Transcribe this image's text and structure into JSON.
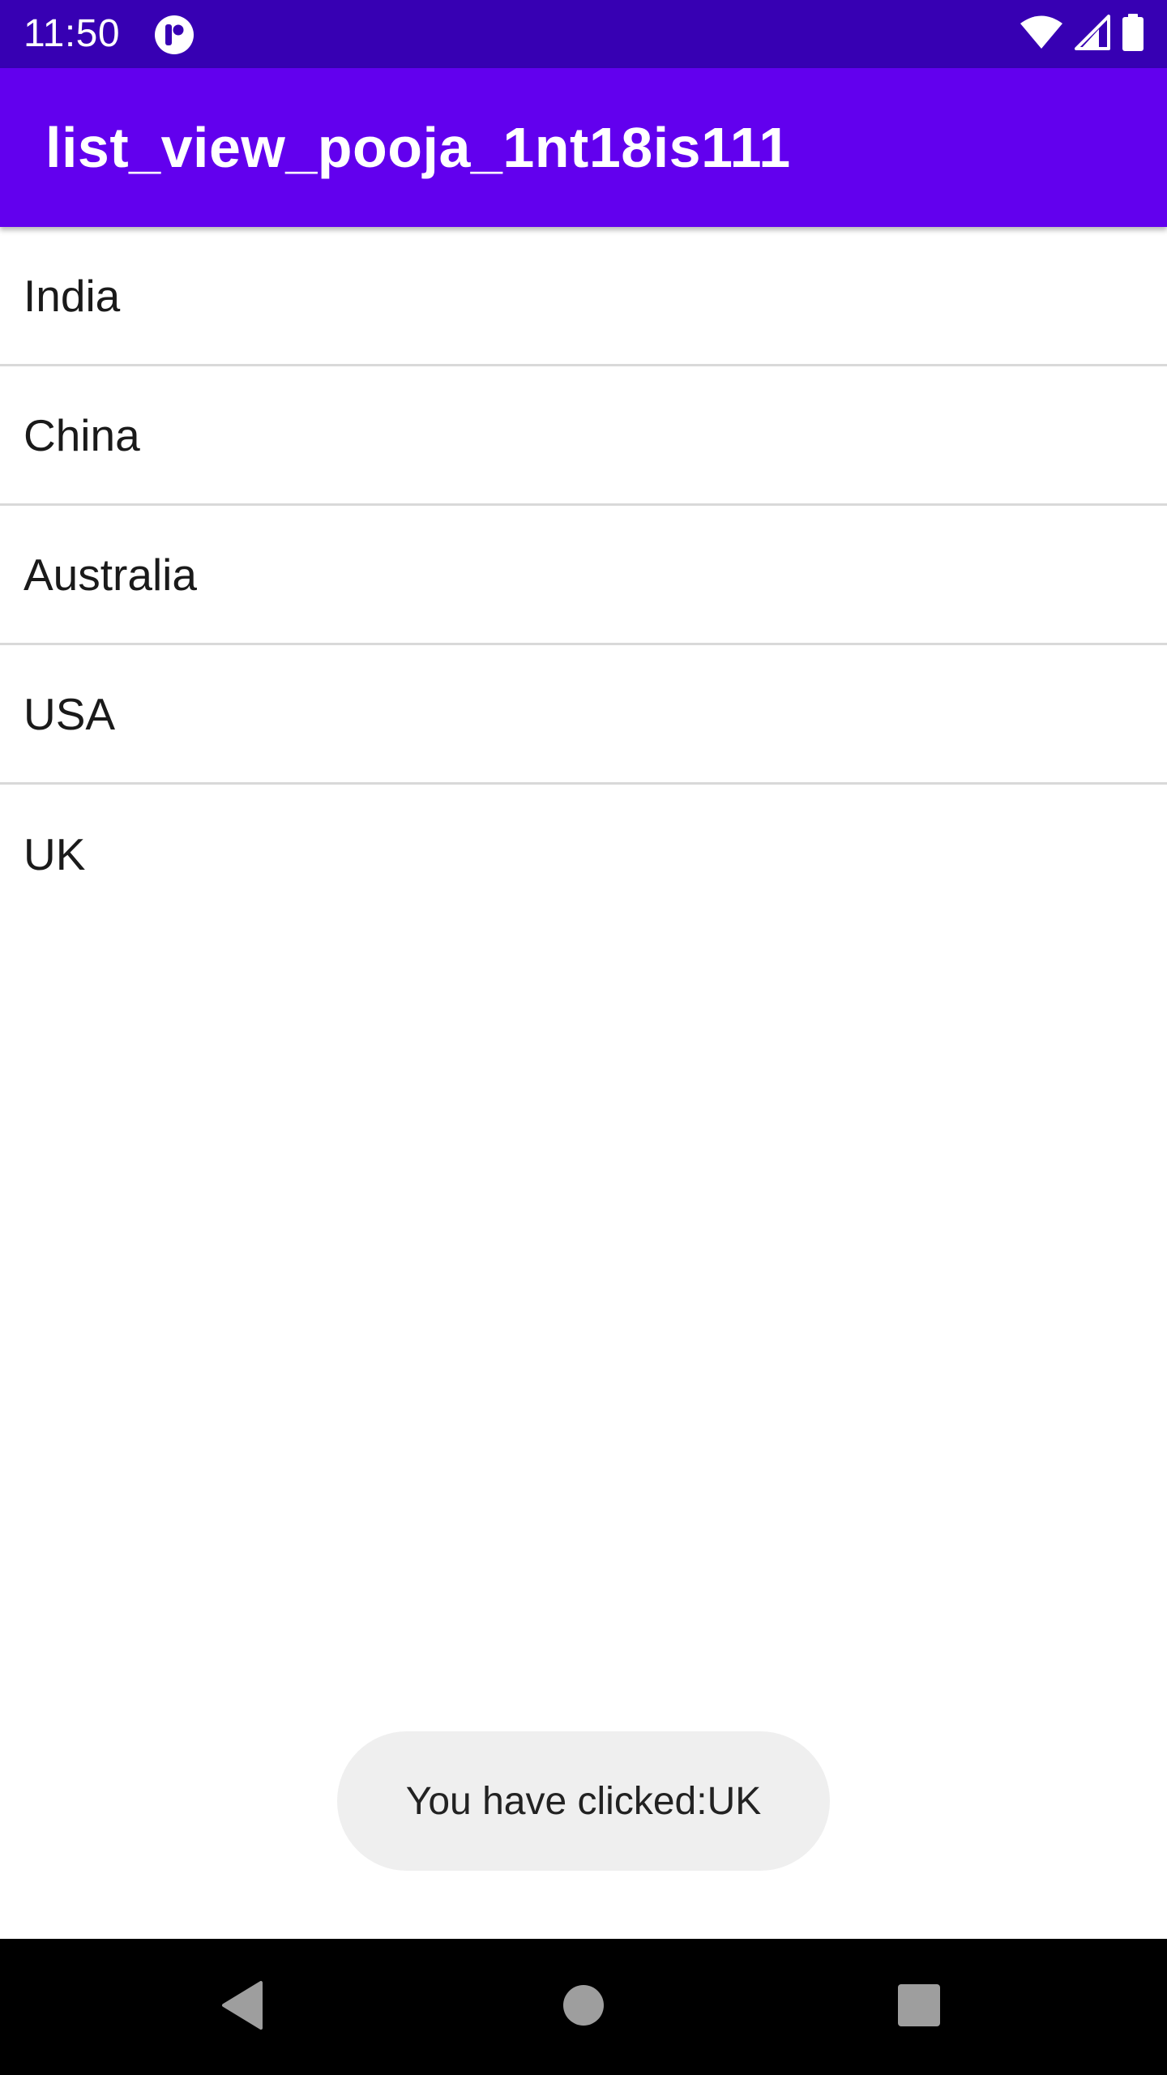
{
  "status_bar": {
    "time": "11:50",
    "icons": [
      "app-notification-icon",
      "wifi-icon",
      "cell-signal-icon",
      "battery-icon"
    ],
    "background": "#3700B3"
  },
  "app_bar": {
    "title": "list_view_pooja_1nt18is111",
    "background": "#6200EE"
  },
  "list": {
    "items": [
      {
        "label": "India"
      },
      {
        "label": "China"
      },
      {
        "label": "Australia"
      },
      {
        "label": "USA"
      },
      {
        "label": "UK"
      }
    ]
  },
  "toast": {
    "message": "You have clicked:UK"
  },
  "nav_bar": {
    "buttons": [
      "back-icon",
      "home-icon",
      "recents-icon"
    ]
  }
}
